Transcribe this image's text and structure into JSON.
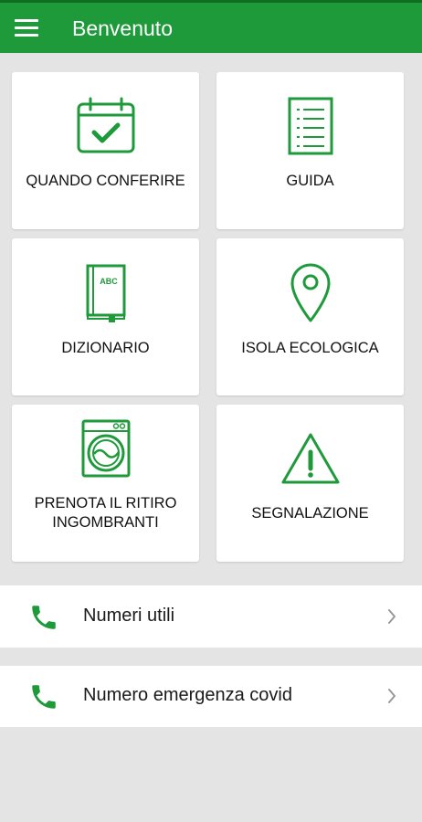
{
  "appbar": {
    "title": "Benvenuto",
    "menu_icon": "hamburger-menu-icon"
  },
  "brand_color": "#1e9a3b",
  "tiles": [
    {
      "label": "QUANDO CONFERIRE",
      "icon": "calendar-check-icon"
    },
    {
      "label": "GUIDA",
      "icon": "document-list-icon"
    },
    {
      "label": "DIZIONARIO",
      "icon": "dictionary-book-icon",
      "icon_text": "ABC"
    },
    {
      "label": "ISOLA ECOLOGICA",
      "icon": "location-pin-icon"
    },
    {
      "label_line1": "PRENOTA IL RITIRO",
      "label_line2": "INGOMBRANTI",
      "icon": "washing-machine-icon"
    },
    {
      "label": "SEGNALAZIONE",
      "icon": "warning-triangle-icon"
    }
  ],
  "list": [
    {
      "label": "Numeri utili",
      "icon": "phone-icon",
      "chevron": "chevron-right-icon"
    },
    {
      "label": "Numero emergenza covid",
      "icon": "phone-icon",
      "chevron": "chevron-right-icon"
    }
  ]
}
